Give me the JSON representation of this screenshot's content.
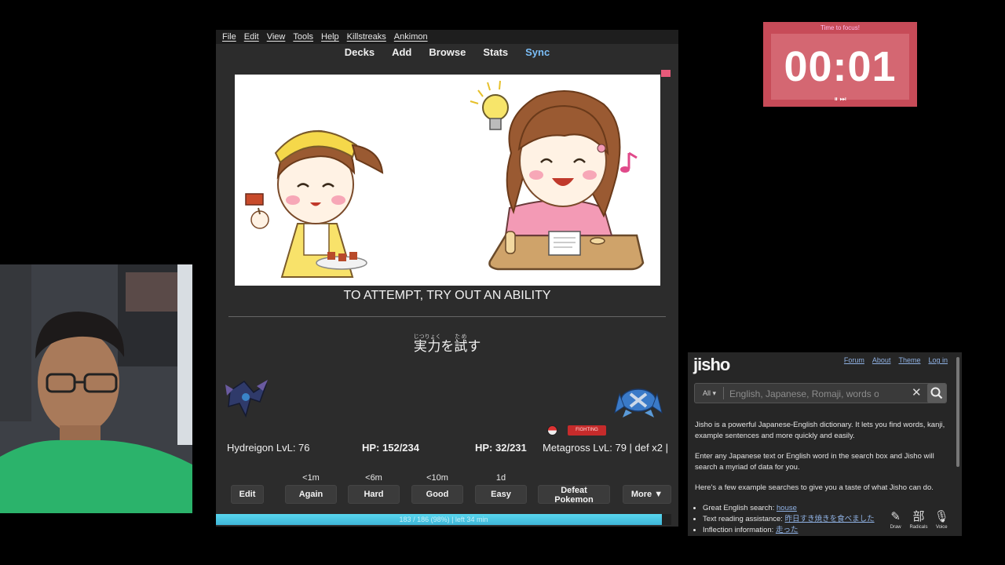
{
  "anki": {
    "menu": [
      "File",
      "Edit",
      "View",
      "Tools",
      "Help",
      "Killstreaks",
      "Ankimon"
    ],
    "toolbar": [
      "Decks",
      "Add",
      "Browse",
      "Stats",
      "Sync"
    ],
    "card": {
      "front_text": "TO ATTEMPT, TRY OUT AN ABILITY",
      "back": {
        "kanji1": "実力",
        "reading1": "じつりょく",
        "kana1": "を",
        "kanji2": "試",
        "reading2": "ため",
        "kana2": "す"
      }
    },
    "battle": {
      "player": "Hydreigon LvL: 76",
      "player_hp": "HP: 152/234",
      "enemy_hp": "HP: 32/231",
      "enemy": "Metagross LvL: 79 | def x2 |",
      "enemy_type": "FIGHTING"
    },
    "answers": [
      {
        "due": "",
        "label": "Edit"
      },
      {
        "due": "<1m",
        "label": "Again"
      },
      {
        "due": "<6m",
        "label": "Hard"
      },
      {
        "due": "<10m",
        "label": "Good"
      },
      {
        "due": "1d",
        "label": "Easy"
      },
      {
        "due": "",
        "label": "Defeat Pokemon"
      },
      {
        "due": "",
        "label": "More ▼"
      }
    ],
    "progress": {
      "text": "183 / 186 (98%) | left 34 min",
      "fraction": 0.98
    }
  },
  "timer": {
    "label": "Time to focus!",
    "time": "00:01",
    "controls": "⏸ ⏭"
  },
  "jisho": {
    "logo": "jisho",
    "links": [
      "Forum",
      "About",
      "Theme",
      "Log in"
    ],
    "filter": "All ▾",
    "placeholder": "English, Japanese, Romaji, words or text",
    "clear": "✕",
    "p1": "Jisho is a powerful Japanese-English dictionary. It lets you find words, kanji, example sentences and more quickly and easily.",
    "p2": "Enter any Japanese text or English word in the search box and Jisho will search a myriad of data for you.",
    "p3": "Here's a few example searches to give you a taste of what Jisho can do.",
    "examples": [
      {
        "label": "Great English search: ",
        "link": "house"
      },
      {
        "label": "Text reading assistance: ",
        "link": "昨日すき焼きを食べました"
      },
      {
        "label": "Inflection information: ",
        "link": "走った"
      }
    ],
    "tools": [
      {
        "icon": "✎",
        "label": "Draw"
      },
      {
        "icon": "部",
        "label": "Radicals"
      },
      {
        "icon": "🎙",
        "label": "Voice"
      }
    ]
  },
  "colors": {
    "accent_sync": "#7bbef7",
    "timer_bg": "#c74b58",
    "progress": "#4fc7e4",
    "fighting": "#c62b2b"
  }
}
